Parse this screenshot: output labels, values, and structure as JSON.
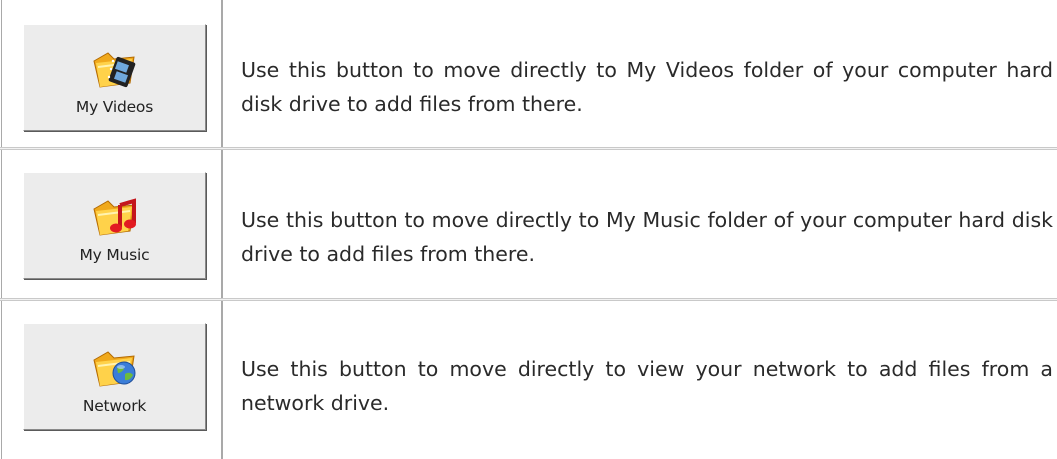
{
  "rows": [
    {
      "button_label": "My Videos",
      "icon": "folder-film-icon",
      "description": "Use this button to move directly to My Videos folder of your computer hard disk drive to add files from there."
    },
    {
      "button_label": "My Music",
      "icon": "folder-music-note-icon",
      "description": "Use this button to move directly to My Music folder of your computer hard disk drive to add files from there."
    },
    {
      "button_label": "Network",
      "icon": "folder-globe-icon",
      "description": "Use this button to move directly to view your network to add files from a network drive."
    }
  ]
}
